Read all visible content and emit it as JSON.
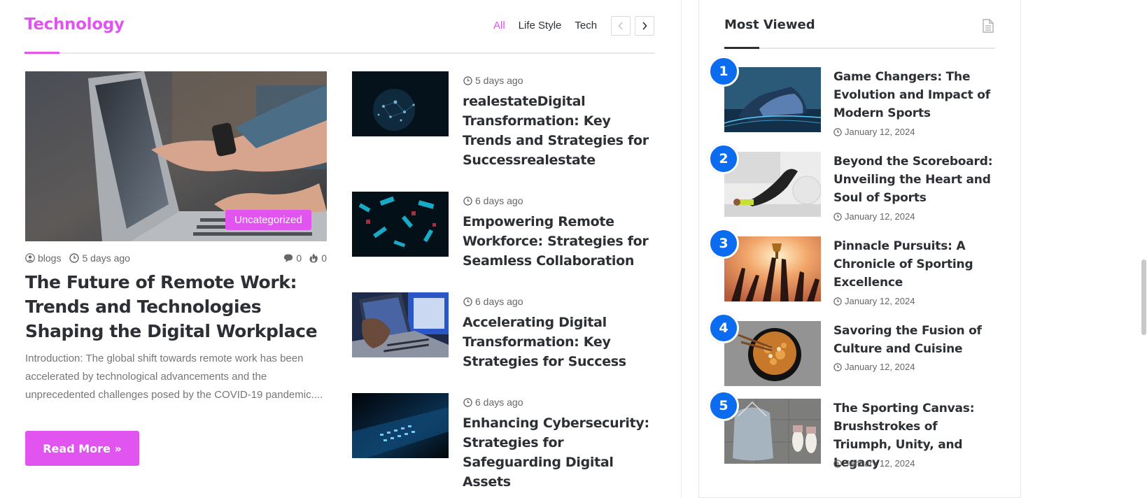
{
  "technology": {
    "title": "Technology",
    "filters": [
      {
        "label": "All",
        "active": true
      },
      {
        "label": "Life Style",
        "active": false
      },
      {
        "label": "Tech",
        "active": false
      }
    ],
    "accent_color": "#e154f0",
    "featured": {
      "category": "Uncategorized",
      "author": "blogs",
      "date": "5 days ago",
      "comments": "0",
      "views": "0",
      "title": "The Future of Remote Work: Trends and Technologies Shaping the Digital Workplace",
      "excerpt": "Introduction: The global shift towards remote work has been accelerated by technological advancements and the unprecedented challenges posed by the COVID-19 pandemic....",
      "read_more": "Read More »"
    },
    "posts": [
      {
        "date": "5 days ago",
        "title": "realestateDigital Transformation: Key Trends and Strategies for Successrealestate"
      },
      {
        "date": "6 days ago",
        "title": "Empowering Remote Workforce: Strategies for Seamless Collaboration"
      },
      {
        "date": "6 days ago",
        "title": "Accelerating Digital Transformation: Key Strategies for Success"
      },
      {
        "date": "6 days ago",
        "title": "Enhancing Cybersecurity: Strategies for Safeguarding Digital Assets"
      }
    ]
  },
  "most_viewed": {
    "title": "Most Viewed",
    "badge_color": "#0b6cf0",
    "items": [
      {
        "rank": "1",
        "title": "Game Changers: The Evolution and Impact of Modern Sports",
        "date": "January 12, 2024"
      },
      {
        "rank": "2",
        "title": "Beyond the Scoreboard: Unveiling the Heart and Soul of Sports",
        "date": "January 12, 2024"
      },
      {
        "rank": "3",
        "title": "Pinnacle Pursuits: A Chronicle of Sporting Excellence",
        "date": "January 12, 2024"
      },
      {
        "rank": "4",
        "title": "Savoring the Fusion of Culture and Cuisine",
        "date": "January 12, 2024"
      },
      {
        "rank": "5",
        "title": "The Sporting Canvas: Brushstrokes of Triumph, Unity, and Legacy",
        "date": "January 12, 2024"
      }
    ]
  }
}
